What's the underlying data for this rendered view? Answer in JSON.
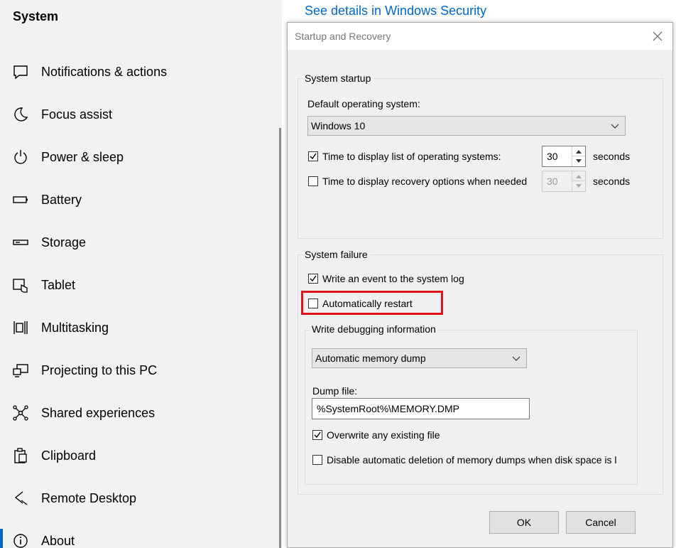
{
  "sidebar": {
    "title": "System",
    "items": [
      {
        "label": "Notifications & actions",
        "icon": "notifications-icon"
      },
      {
        "label": "Focus assist",
        "icon": "moon-icon"
      },
      {
        "label": "Power & sleep",
        "icon": "power-icon"
      },
      {
        "label": "Battery",
        "icon": "battery-icon"
      },
      {
        "label": "Storage",
        "icon": "storage-icon"
      },
      {
        "label": "Tablet",
        "icon": "tablet-icon"
      },
      {
        "label": "Multitasking",
        "icon": "multitasking-icon"
      },
      {
        "label": "Projecting to this PC",
        "icon": "projecting-icon"
      },
      {
        "label": "Shared experiences",
        "icon": "shared-experiences-icon"
      },
      {
        "label": "Clipboard",
        "icon": "clipboard-icon"
      },
      {
        "label": "Remote Desktop",
        "icon": "remote-desktop-icon"
      },
      {
        "label": "About",
        "icon": "info-icon"
      }
    ]
  },
  "main": {
    "details_link": "See details in Windows Security"
  },
  "dialog": {
    "title": "Startup and Recovery",
    "system_startup": {
      "group_title": "System startup",
      "default_os_label": "Default operating system:",
      "default_os_value": "Windows 10",
      "display_list": {
        "label": "Time to display list of operating systems:",
        "checked": true,
        "value": "30",
        "unit": "seconds"
      },
      "display_recovery": {
        "label": "Time to display recovery options when needed",
        "checked": false,
        "value": "30",
        "unit": "seconds"
      }
    },
    "system_failure": {
      "group_title": "System failure",
      "write_event": {
        "label": "Write an event to the system log",
        "checked": true
      },
      "auto_restart": {
        "label": "Automatically restart",
        "checked": false
      },
      "debug": {
        "group_title": "Write debugging information",
        "dump_type": "Automatic memory dump",
        "dump_file_label": "Dump file:",
        "dump_file_value": "%SystemRoot%\\MEMORY.DMP",
        "overwrite": {
          "label": "Overwrite any existing file",
          "checked": true
        },
        "disable_auto_delete": {
          "label": "Disable automatic deletion of memory dumps when disk space is l",
          "checked": false
        }
      }
    },
    "buttons": {
      "ok": "OK",
      "cancel": "Cancel"
    }
  },
  "colors": {
    "accent": "#0067c0",
    "highlight": "#e0141e"
  }
}
